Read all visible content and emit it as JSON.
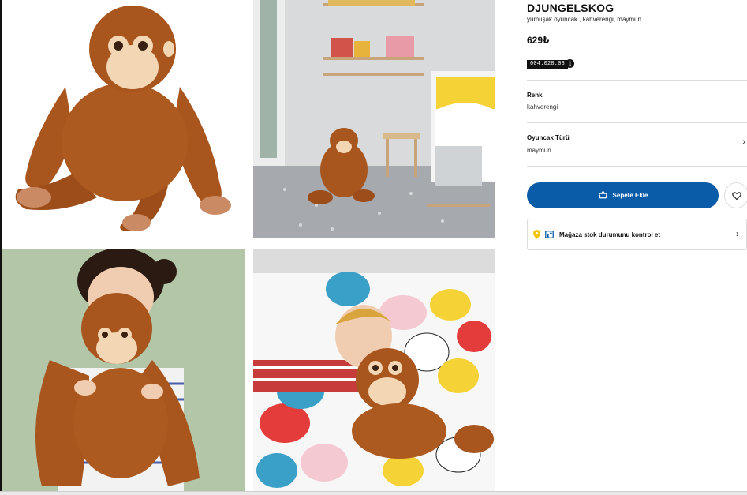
{
  "product": {
    "name": "DJUNGELSKOG",
    "description": "yumuşak oyuncak , kahverengi, maymun",
    "price": "629₺",
    "article_number": "004.028.08"
  },
  "attributes": [
    {
      "label": "Renk",
      "value": "kahverengi"
    },
    {
      "label": "Oyuncak Türü",
      "value": "maymun"
    }
  ],
  "actions": {
    "add_to_cart": "Sepete Ekle",
    "stock_check": "Mağaza stok durumunu kontrol et"
  },
  "icons": {
    "info": "info-icon",
    "cart": "cart-icon",
    "favorite": "heart-icon",
    "location": "location-pin-icon",
    "store": "store-icon",
    "chevron": "chevron-right-icon"
  },
  "colors": {
    "accent_blue": "#0a5ca8",
    "pin_yellow": "#f5c400",
    "plush_brown": "#a8551e"
  }
}
